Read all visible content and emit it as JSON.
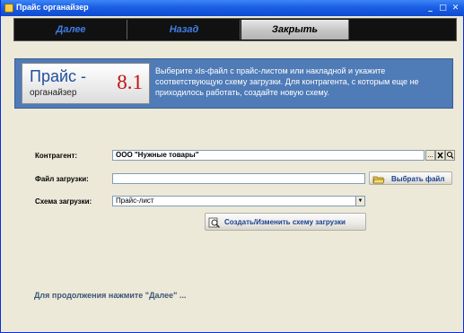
{
  "window": {
    "title": "Прайс органайзер",
    "controls": {
      "minimize": "_",
      "maximize": "□",
      "close": "✕"
    }
  },
  "toolbar": {
    "next_label": "Далее",
    "back_label": "Назад",
    "close_label": "Закрыть"
  },
  "banner": {
    "logo_name": "Прайс -",
    "logo_sub": "органайзер",
    "logo_version": "8.1",
    "description": "Выберите xls-файл с прайс-листом или накладной и укажите соответствующую схему загрузки. Для контрагента, с которым еще не приходилось работать,  создайте новую схему."
  },
  "form": {
    "contractor_label": "Контрагент:",
    "contractor_value": "ООО \"Нужные товары\"",
    "contractor_buttons": [
      "...",
      "✕",
      "🔍"
    ],
    "file_label": "Файл загрузки:",
    "file_value": "",
    "choose_file_label": "Выбрать файл",
    "scheme_label": "Схема загрузки:",
    "scheme_value": "Прайс-лист",
    "create_scheme_label": "Создать/Изменить схему загрузки"
  },
  "footer": {
    "hint": "Для продолжения нажмите \"Далее\" ..."
  },
  "colors": {
    "titlebar": "#1c5fe4",
    "toolbar": "#111111",
    "banner": "#4f7bb7",
    "version": "#c21212",
    "link_text": "#1a3f8f"
  }
}
